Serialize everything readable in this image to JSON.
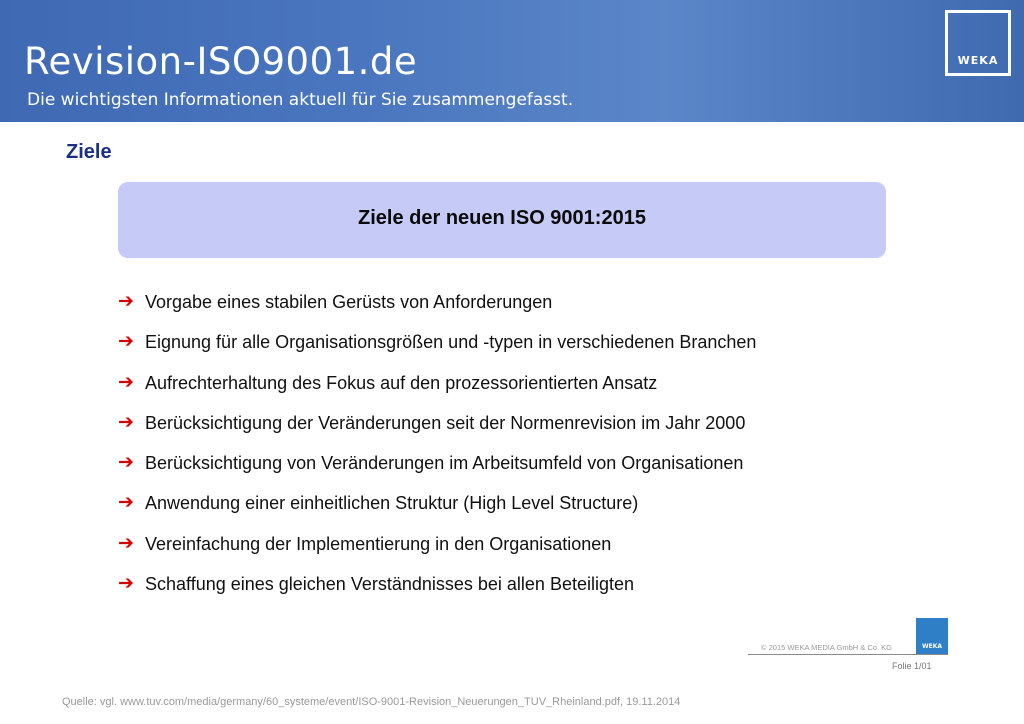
{
  "header": {
    "title": "Revision-ISO9001.de",
    "subtitle": "Die wichtigsten Informationen aktuell für Sie zusammengefasst.",
    "logo": "WEKA"
  },
  "slide": {
    "section_title": "Ziele",
    "box_title": "Ziele der neuen ISO 9001:2015",
    "bullet_icon": "arrow-right-icon",
    "bullet_color": "#d40000",
    "bullets": [
      "Vorgabe eines stabilen Gerüsts von Anforderungen",
      "Eignung für alle Organisationsgrößen und -typen in verschiedenen Branchen",
      "Aufrechterhaltung des Fokus auf den prozessorientierten Ansatz",
      "Berücksichtigung der Veränderungen seit der Normenrevision im Jahr 2000",
      "Berücksichtigung von Veränderungen im Arbeitsumfeld von Organisationen",
      "Anwendung einer einheitlichen Struktur (High Level Structure)",
      "Vereinfachung der Implementierung in den Organisationen",
      "Schaffung eines gleichen Verständnisses bei allen Beteiligten"
    ]
  },
  "footer": {
    "logo": "WEKA",
    "copyright": "© 2015 WEKA MEDIA GmbH & Co. KG",
    "folio": "Folie 1/01",
    "source": "Quelle: vgl. www.tuv.com/media/germany/60_systeme/event/ISO-9001-Revision_Neuerungen_TUV_Rheinland.pdf, 19.11.2014"
  },
  "colors": {
    "header_blue": "#4a76bf",
    "title_blue": "#1b2f85",
    "box_fill": "#c5cbf6"
  }
}
